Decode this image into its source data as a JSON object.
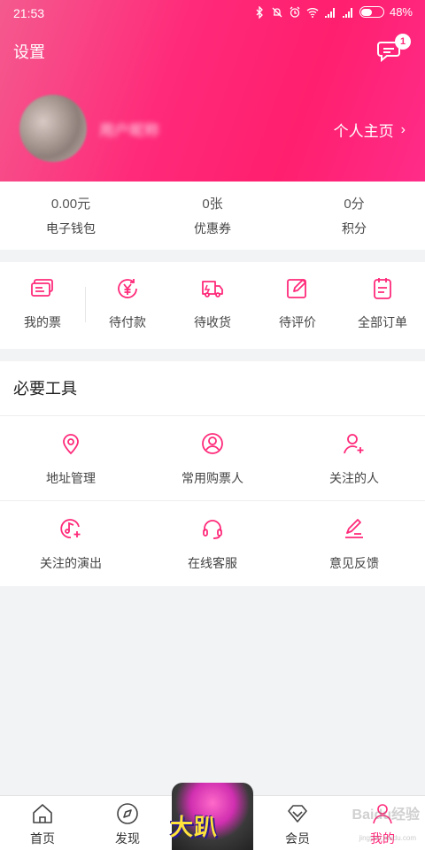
{
  "status_bar": {
    "time": "21:53",
    "battery": "48%",
    "battery_level": 0.48
  },
  "header": {
    "title": "设置",
    "message_badge": "1",
    "nickname": "用户昵称",
    "homepage_link": "个人主页"
  },
  "assets": [
    {
      "value": "0.00元",
      "label": "电子钱包"
    },
    {
      "value": "0张",
      "label": "优惠券"
    },
    {
      "value": "0分",
      "label": "积分"
    }
  ],
  "orders": [
    {
      "label": "我的票",
      "icon": "ticket-icon"
    },
    {
      "label": "待付款",
      "icon": "yen-icon"
    },
    {
      "label": "待收货",
      "icon": "truck-icon"
    },
    {
      "label": "待评价",
      "icon": "edit-icon"
    },
    {
      "label": "全部订单",
      "icon": "clipboard-icon"
    }
  ],
  "tools": {
    "title": "必要工具",
    "items": [
      {
        "label": "地址管理",
        "icon": "location-icon"
      },
      {
        "label": "常用购票人",
        "icon": "user-circle-icon"
      },
      {
        "label": "关注的人",
        "icon": "user-plus-icon"
      },
      {
        "label": "关注的演出",
        "icon": "music-plus-icon"
      },
      {
        "label": "在线客服",
        "icon": "headset-icon"
      },
      {
        "label": "意见反馈",
        "icon": "pen-icon"
      }
    ]
  },
  "tabbar": {
    "items": [
      {
        "label": "首页",
        "icon": "home-icon"
      },
      {
        "label": "发现",
        "icon": "compass-icon"
      },
      {
        "label": "会员",
        "icon": "diamond-icon"
      },
      {
        "label": "我的",
        "icon": "person-icon"
      }
    ],
    "promo_text": "大趴"
  },
  "watermark": {
    "text": "Baidu经验",
    "sub": "jingyan.baidu.com"
  },
  "colors": {
    "accent": "#ff2a7a",
    "header_start": "#f45a8e",
    "header_end": "#ff2c89"
  }
}
